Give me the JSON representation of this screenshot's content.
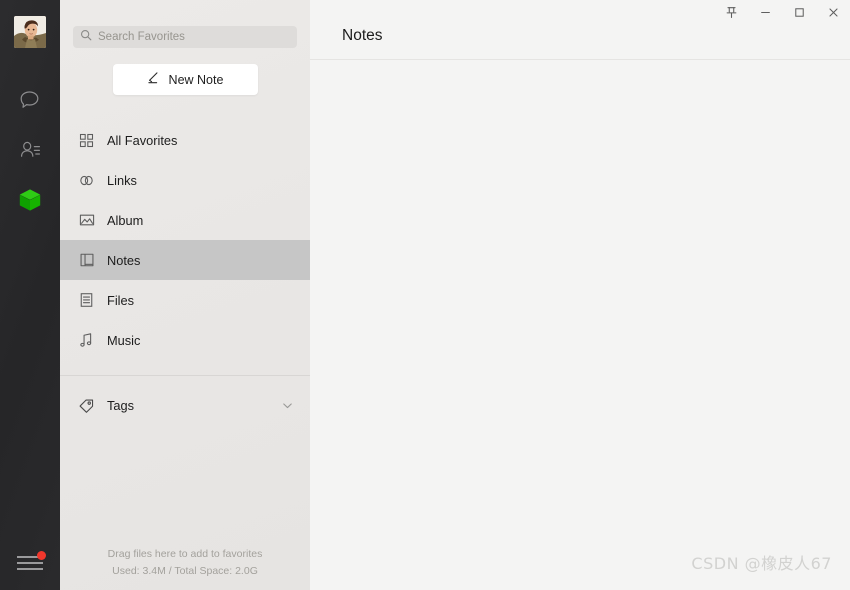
{
  "window": {
    "title": "Notes",
    "controls": [
      {
        "name": "pin-icon",
        "label": "Pin"
      },
      {
        "name": "minimize-icon",
        "label": "Minimize"
      },
      {
        "name": "maximize-icon",
        "label": "Maximize"
      },
      {
        "name": "close-icon",
        "label": "Close"
      }
    ]
  },
  "rail": {
    "avatar_alt": "User avatar",
    "items": [
      {
        "icon": "chat-icon",
        "label": "Chat"
      },
      {
        "icon": "contacts-icon",
        "label": "Contacts"
      },
      {
        "icon": "cube-icon",
        "label": "Favorites"
      }
    ],
    "menu": {
      "icon": "hamburger-menu-icon",
      "label": "Menu",
      "badge": true
    }
  },
  "sidebar": {
    "search": {
      "placeholder": "Search Favorites",
      "value": ""
    },
    "new_note_label": "New Note",
    "items": [
      {
        "icon": "grid-icon",
        "label": "All Favorites",
        "active": false
      },
      {
        "icon": "link-icon",
        "label": "Links",
        "active": false
      },
      {
        "icon": "album-icon",
        "label": "Album",
        "active": false
      },
      {
        "icon": "book-icon",
        "label": "Notes",
        "active": true
      },
      {
        "icon": "file-icon",
        "label": "Files",
        "active": false
      },
      {
        "icon": "music-icon",
        "label": "Music",
        "active": false
      }
    ],
    "tags": {
      "label": "Tags",
      "icon": "tag-icon",
      "chevron": "chevron-down-icon"
    },
    "footer": {
      "drag_hint": "Drag files here to add to favorites",
      "storage": "Used: 3.4M / Total Space: 2.0G"
    }
  },
  "main": {
    "header_title": "Notes",
    "watermark": "CSDN @橡皮人67"
  },
  "colors": {
    "rail_bg": "#2a2a2c",
    "sidebar_bg": "#e9e7e5",
    "main_bg": "#f4f4f3",
    "active_row": "#c6c6c6",
    "accent_green": "#16b400",
    "badge_red": "#f1372c"
  }
}
